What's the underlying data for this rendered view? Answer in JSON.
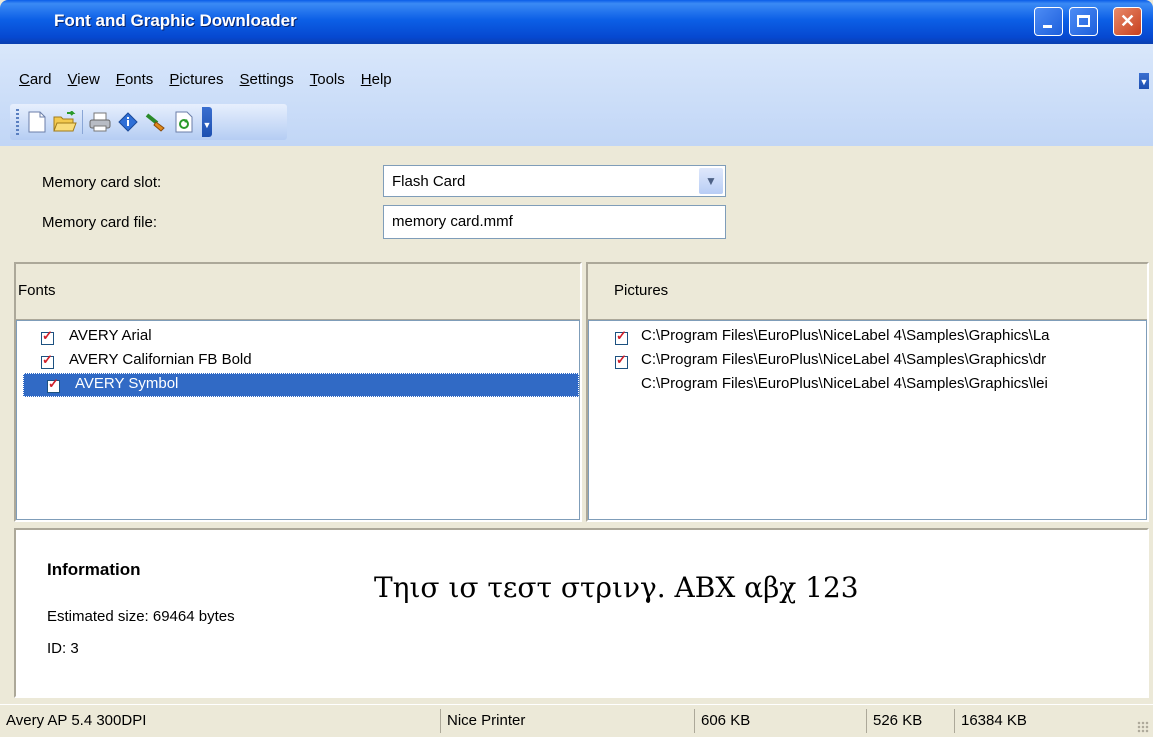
{
  "window": {
    "title": "Font and Graphic Downloader"
  },
  "menu": {
    "items": [
      {
        "label": "Card",
        "accel": "C",
        "rest": "ard"
      },
      {
        "label": "View",
        "accel": "V",
        "rest": "iew"
      },
      {
        "label": "Fonts",
        "accel": "F",
        "rest": "onts"
      },
      {
        "label": "Pictures",
        "accel": "P",
        "rest": "ictures"
      },
      {
        "label": "Settings",
        "accel": "S",
        "rest": "ettings"
      },
      {
        "label": "Tools",
        "accel": "T",
        "rest": "ools"
      },
      {
        "label": "Help",
        "accel": "H",
        "rest": "elp"
      }
    ]
  },
  "toolbar": {
    "icons": [
      "new-document-icon",
      "open-folder-icon",
      "print-icon",
      "info-icon",
      "brush-icon",
      "refresh-icon"
    ]
  },
  "form": {
    "slot_label": "Memory card slot:",
    "slot_value": "Flash Card",
    "file_label": "Memory card file:",
    "file_value": "memory card.mmf"
  },
  "fonts": {
    "header": "Fonts",
    "items": [
      {
        "label": "AVERY Arial",
        "checked": true,
        "selected": false
      },
      {
        "label": "AVERY Californian FB Bold",
        "checked": true,
        "selected": false
      },
      {
        "label": "AVERY Symbol",
        "checked": true,
        "selected": true
      }
    ]
  },
  "pictures": {
    "header": "Pictures",
    "items": [
      {
        "label": "C:\\Program Files\\EuroPlus\\NiceLabel 4\\Samples\\Graphics\\La",
        "checked": true
      },
      {
        "label": "C:\\Program Files\\EuroPlus\\NiceLabel 4\\Samples\\Graphics\\dr",
        "checked": true
      },
      {
        "label": "C:\\Program Files\\EuroPlus\\NiceLabel 4\\Samples\\Graphics\\lei",
        "checked": false
      }
    ]
  },
  "info": {
    "heading": "Information",
    "size": "Estimated size: 69464 bytes",
    "id": "ID: 3",
    "sample": "Τηισ ισ τεστ στρινγ. ΑΒΧ αβχ 123"
  },
  "status": {
    "printer_model": "Avery AP 5.4 300DPI",
    "printer_name": "Nice Printer",
    "mem1": "606 KB",
    "mem2": "526 KB",
    "mem3": "16384 KB"
  }
}
